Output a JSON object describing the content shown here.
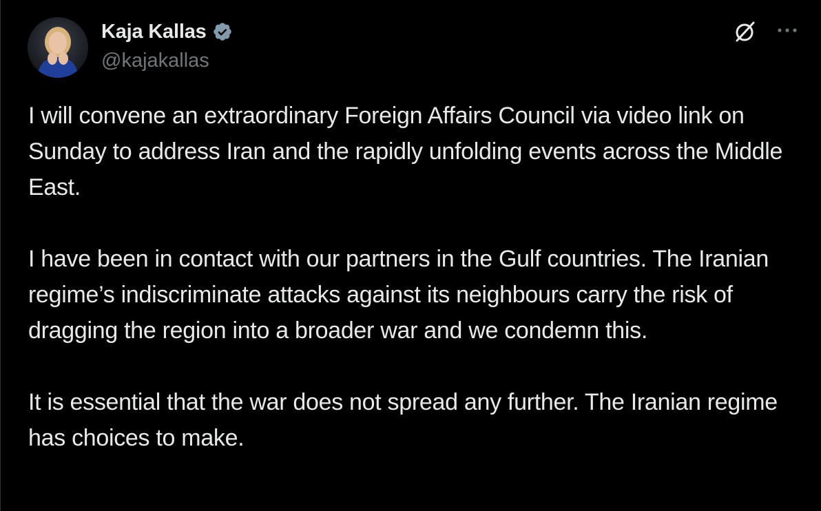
{
  "author": {
    "display_name": "Kaja Kallas",
    "handle": "@kajakallas",
    "verified": true,
    "avatar_icon": "profile-photo"
  },
  "actions": {
    "grok_icon": "grok-icon",
    "more_icon": "more-horizontal-icon"
  },
  "tweet": {
    "paragraphs": [
      "I will convene an extraordinary Foreign Affairs Council via video link on Sunday to address Iran and the rapidly unfolding events across the Middle East.",
      "I have been in contact with our partners in the Gulf countries. The Iranian regime’s indiscriminate attacks against its neighbours carry the risk of dragging the region into a broader war and we condemn this.",
      "It is essential that the war does not spread any further. The Iranian regime has choices to make."
    ]
  },
  "colors": {
    "background": "#000000",
    "text": "#e7e9ea",
    "secondary_text": "#71767b",
    "verified_badge": "#829aab"
  }
}
